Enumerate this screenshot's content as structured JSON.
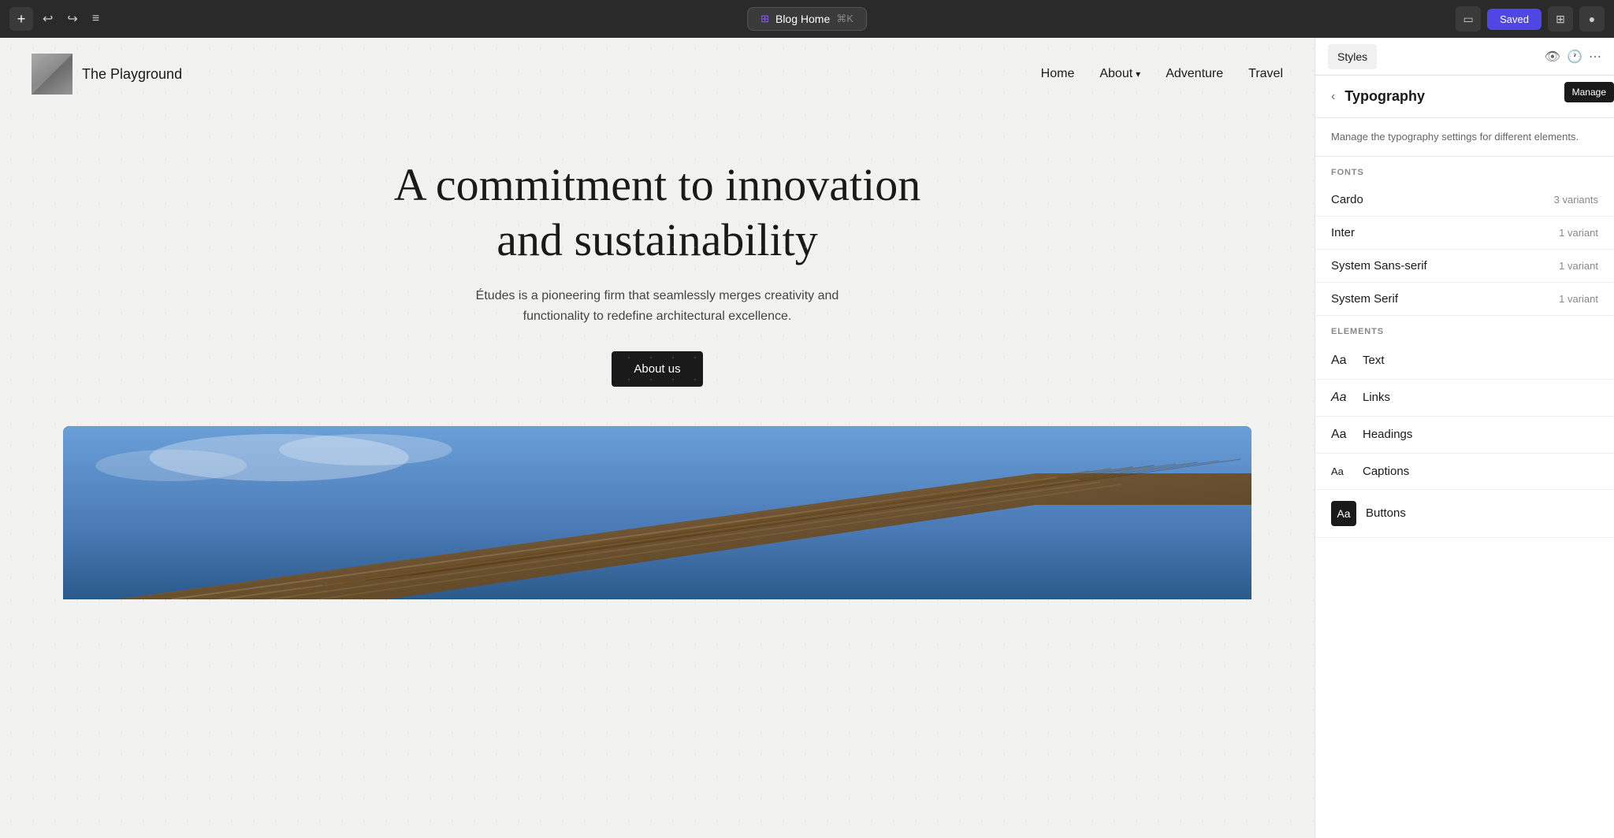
{
  "toolbar": {
    "add_label": "+",
    "undo_label": "↩",
    "redo_label": "↪",
    "menu_label": "≡",
    "page_icon": "⊞",
    "page_name": "Blog Home",
    "shortcut": "⌘K",
    "saved_label": "Saved",
    "device_icon": "▭",
    "avatar_icon": "●"
  },
  "nav": {
    "brand": "The Playground",
    "links": [
      {
        "label": "Home",
        "has_chevron": false
      },
      {
        "label": "About",
        "has_chevron": true
      },
      {
        "label": "Adventure",
        "has_chevron": false
      },
      {
        "label": "Travel",
        "has_chevron": false
      }
    ]
  },
  "hero": {
    "title": "A commitment to innovation and sustainability",
    "subtitle": "Études is a pioneering firm that seamlessly merges creativity and functionality to redefine architectural excellence.",
    "cta_label": "About us"
  },
  "panel": {
    "tabs": [
      {
        "label": "Styles",
        "active": true
      }
    ],
    "typography": {
      "title": "Typography",
      "description": "Manage the typography settings for different elements.",
      "fonts_label": "FONTS",
      "fonts": [
        {
          "name": "Cardo",
          "variants": "3 variants"
        },
        {
          "name": "Inter",
          "variants": "1 variant"
        },
        {
          "name": "System Sans-serif",
          "variants": "1 variant"
        },
        {
          "name": "System Serif",
          "variants": "1 variant"
        }
      ],
      "elements_label": "ELEMENTS",
      "elements": [
        {
          "label": "Text",
          "filled": false
        },
        {
          "label": "Links",
          "filled": false
        },
        {
          "label": "Headings",
          "filled": false
        },
        {
          "label": "Captions",
          "filled": false
        },
        {
          "label": "Buttons",
          "filled": true
        }
      ],
      "tooltip": "Manage"
    }
  }
}
